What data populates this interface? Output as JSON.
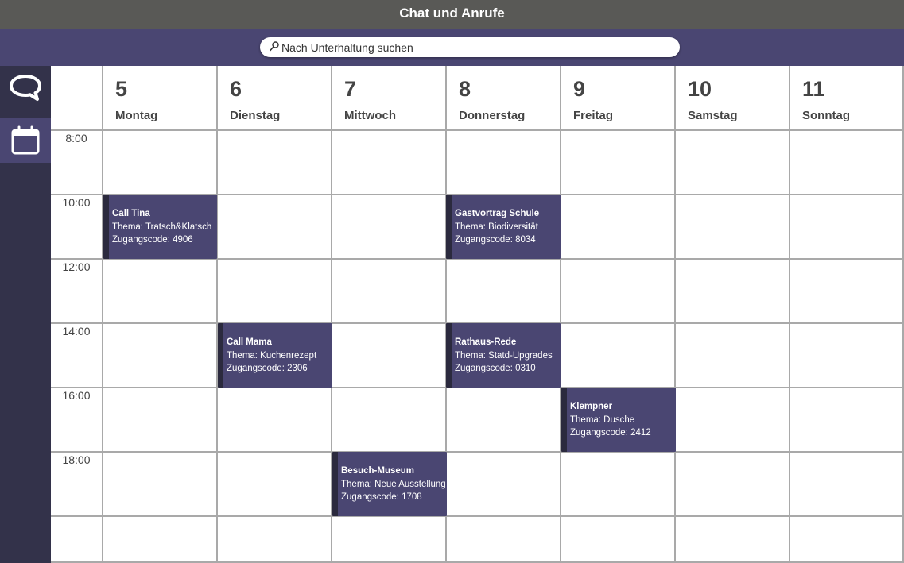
{
  "window": {
    "title": "Chat und Anrufe"
  },
  "search": {
    "placeholder": "Nach Unterhaltung suchen"
  },
  "sidebar": {
    "items": [
      {
        "icon": "chat-bubble-icon",
        "label": ""
      },
      {
        "icon": "calendar-icon",
        "label": "",
        "active": true
      }
    ]
  },
  "calendar": {
    "days": [
      {
        "num": "5",
        "name": "Montag"
      },
      {
        "num": "6",
        "name": "Dienstag"
      },
      {
        "num": "7",
        "name": "Mittwoch"
      },
      {
        "num": "8",
        "name": "Donnerstag"
      },
      {
        "num": "9",
        "name": "Freitag"
      },
      {
        "num": "10",
        "name": "Samstag"
      },
      {
        "num": "11",
        "name": "Sonntag"
      }
    ],
    "times": [
      "8:00",
      "10:00",
      "12:00",
      "14:00",
      "16:00",
      "18:00"
    ],
    "events": [
      {
        "title": "Call Tina",
        "topic": "Thema: Tratsch&Klatsch",
        "code": "Zugangscode: 4906"
      },
      {
        "title": "Gastvortrag Schule",
        "topic": "Thema: Biodiversität",
        "code": "Zugangscode: 8034"
      },
      {
        "title": "Call Mama",
        "topic": "Thema: Kuchenrezept",
        "code": "Zugangscode: 2306"
      },
      {
        "title": "Rathaus-Rede",
        "topic": "Thema: Statd-Upgrades",
        "code": "Zugangscode: 0310"
      },
      {
        "title": "Klempner",
        "topic": "Thema: Dusche",
        "code": "Zugangscode: 2412"
      },
      {
        "title": "Besuch-Museum",
        "topic": "Thema: Neue Ausstellung",
        "code": "Zugangscode: 1708"
      }
    ]
  },
  "colors": {
    "titlebar": "#595956",
    "accent": "#4a4672",
    "sidebar": "#33324a",
    "event_border": "#2b2a3e"
  }
}
